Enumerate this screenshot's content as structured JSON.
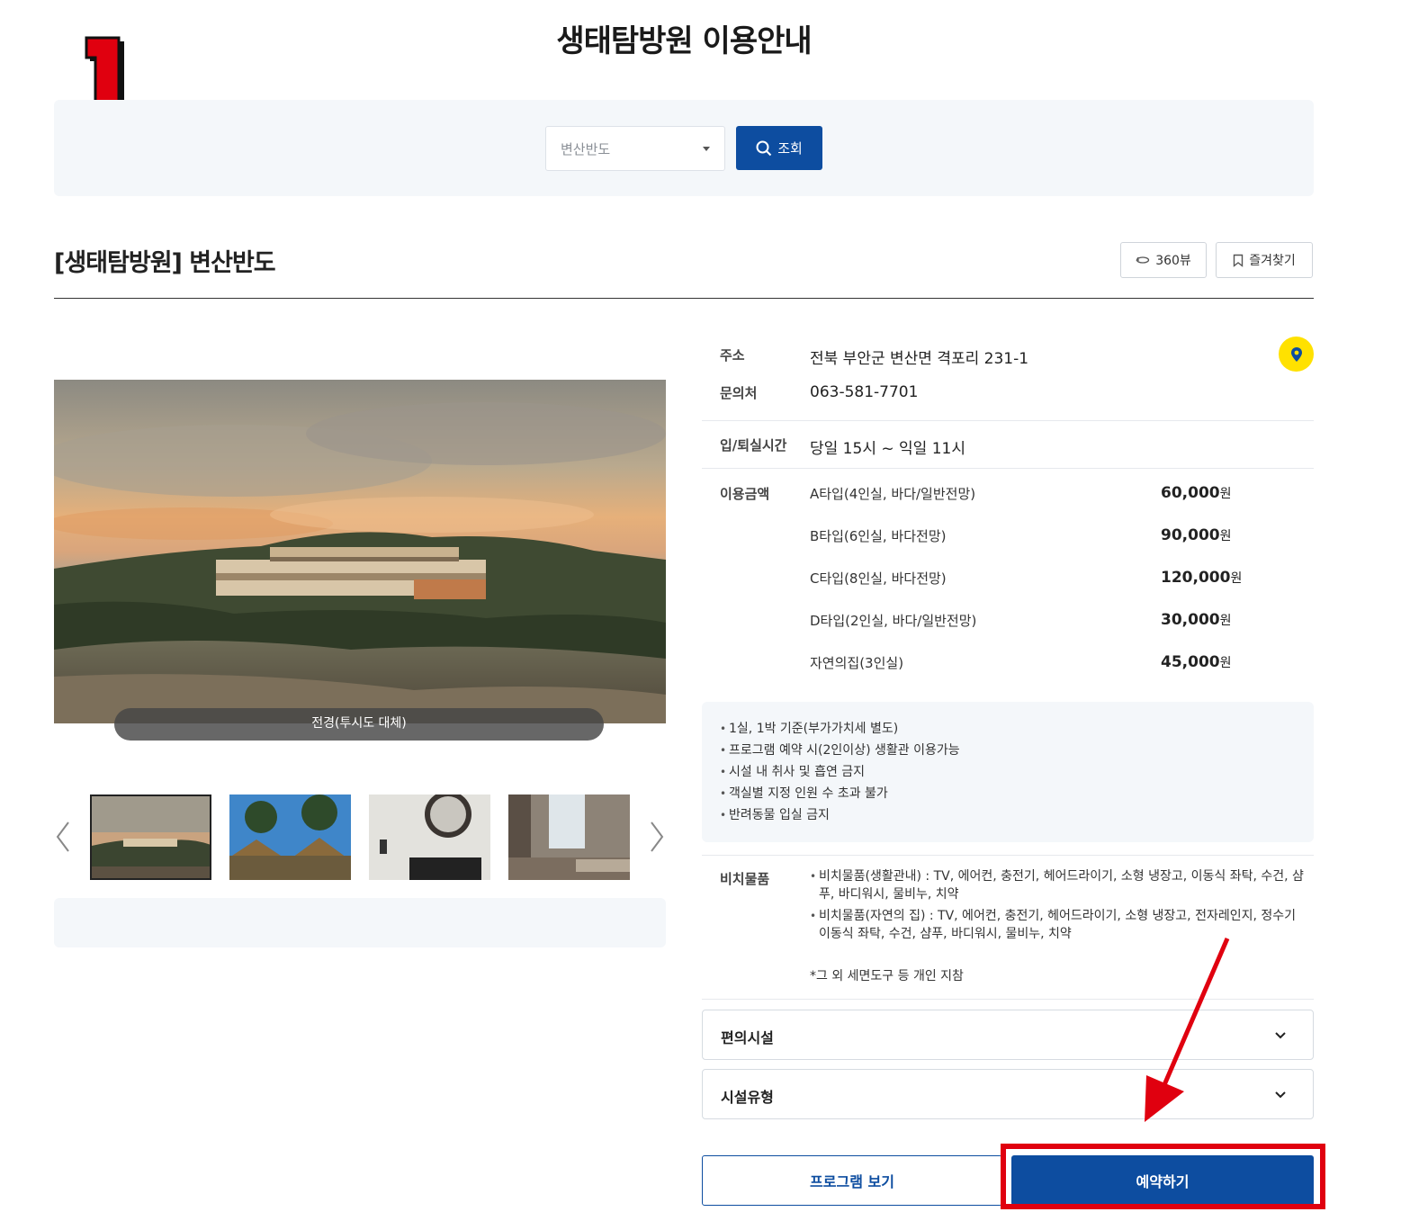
{
  "page": {
    "title": "생태탐방원 이용안내"
  },
  "annotation": {
    "step": "1",
    "accent_color": "#e0000f"
  },
  "search": {
    "selected_region": "변산반도",
    "button_label": "조회",
    "button_color": "#0d4da0"
  },
  "facility": {
    "title": "[생태탐방원] 변산반도",
    "view360_label": "360뷰",
    "favorite_label": "즐겨찾기"
  },
  "gallery": {
    "caption": "전경(투시도 대체)",
    "thumbnail_count": 4,
    "active_index": 0
  },
  "info": {
    "address_label": "주소",
    "address": "전북 부안군 변산면 격포리 231-1",
    "contact_label": "문의처",
    "contact": "063-581-7701",
    "checkin_label": "입/퇴실시간",
    "checkin": "당일 15시 ~ 익일 11시",
    "price_label": "이용금액",
    "prices": [
      {
        "name": "A타입(4인실, 바다/일반전망)",
        "amount": "60,000",
        "unit": "원"
      },
      {
        "name": "B타입(6인실, 바다전망)",
        "amount": "90,000",
        "unit": "원"
      },
      {
        "name": "C타입(8인실, 바다전망)",
        "amount": "120,000",
        "unit": "원"
      },
      {
        "name": "D타입(2인실, 바다/일반전망)",
        "amount": "30,000",
        "unit": "원"
      },
      {
        "name": "자연의집(3인실)",
        "amount": "45,000",
        "unit": "원"
      }
    ],
    "notices": [
      "1실, 1박 기준(부가가치세 별도)",
      "프로그램 예약 시(2인이상) 생활관 이용가능",
      "시설 내 취사 및 흡연 금지",
      "객실별 지정 인원 수 초과 불가",
      "반려동물 입실 금지"
    ],
    "amenities_label": "비치물품",
    "amenities": [
      "비치물품(생활관내) : TV, 에어컨, 충전기, 헤어드라이기, 소형 냉장고, 이동식 좌탁, 수건, 샴푸, 바디워시, 물비누, 치약",
      "비치물품(자연의 집) : TV, 에어컨, 충전기, 헤어드라이기, 소형 냉장고, 전자레인지, 정수기 이동식 좌탁, 수건, 샴푸, 바디워시, 물비누, 치약"
    ],
    "amenities_note": "*그 외 세면도구 등 개인 지참"
  },
  "accordions": [
    {
      "label": "편의시설"
    },
    {
      "label": "시설유형"
    }
  ],
  "actions": {
    "program_label": "프로그램 보기",
    "reserve_label": "예약하기"
  }
}
